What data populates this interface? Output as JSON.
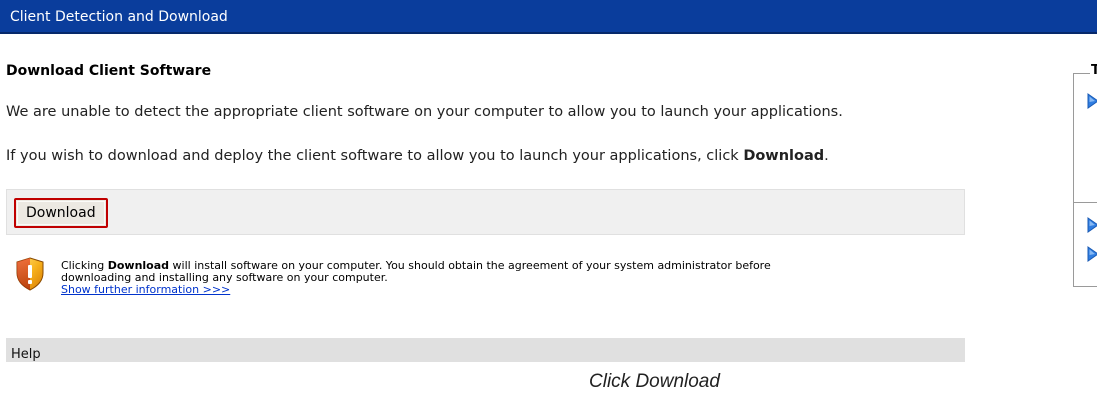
{
  "window": {
    "title": "Client Detection and Download"
  },
  "main": {
    "heading": "Download Client Software",
    "message_1": "We are unable to detect the appropriate client software on your computer to allow you to launch your applications.",
    "message_2_prefix": "If you wish to download and deploy the client software to allow you to launch your applications, click ",
    "message_2_bold": "Download",
    "message_2_suffix": ".",
    "download_button_label": "Download"
  },
  "warning": {
    "icon": "security-shield-warning-icon",
    "prefix": "Clicking ",
    "bold": "Download",
    "line_1_suffix": " will install software on your computer. You should obtain the agreement of your system administrator before",
    "line_2": "downloading and installing any software on your computer.",
    "link_label": "Show further information >>>"
  },
  "help": {
    "label": "Help"
  },
  "side_panel": {
    "title_fragment": "T",
    "items": [
      {
        "icon": "blue-arrow-right-icon"
      },
      {
        "icon": "blue-arrow-right-icon"
      },
      {
        "icon": "blue-arrow-right-icon"
      }
    ]
  },
  "caption": {
    "text": "Click Download"
  },
  "colors": {
    "title_bar": "#0a3d9c",
    "button_highlight_border": "#c00000",
    "link": "#0033cc",
    "panel_bg": "#f0f0f0",
    "help_bar_bg": "#e0e0e0",
    "arrow_blue": "#2f7de1"
  }
}
